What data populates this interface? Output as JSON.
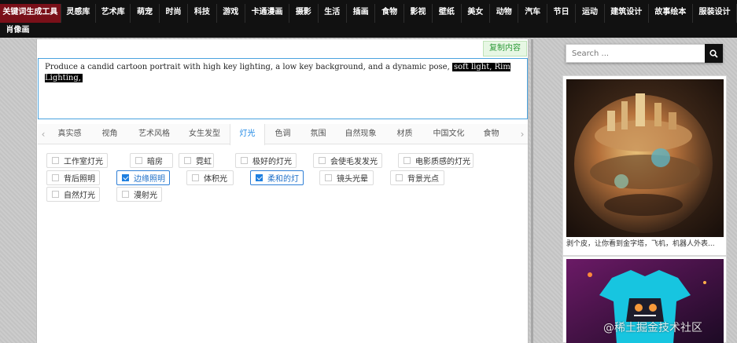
{
  "nav": {
    "row1": [
      "关键词生成工具",
      "灵感库",
      "艺术库",
      "萌宠",
      "时尚",
      "科技",
      "游戏",
      "卡通漫画",
      "摄影",
      "生活",
      "插画",
      "食物",
      "影视",
      "壁纸",
      "美女",
      "动物",
      "汽车",
      "节日",
      "运动",
      "建筑设计",
      "故事绘本",
      "服装设计"
    ],
    "row2": [
      "肖像画"
    ],
    "active": "关键词生成工具"
  },
  "editor": {
    "copy_label": "复制内容",
    "prompt_text": "Produce a candid cartoon portrait with high key lighting, a low key background, and a dynamic pose,",
    "prompt_highlight": "soft light, Rim Lighting,"
  },
  "tabs": {
    "items": [
      "真实感",
      "视角",
      "艺术风格",
      "女生发型",
      "灯光",
      "色调",
      "氛围",
      "自然现象",
      "材质",
      "中国文化",
      "食物"
    ],
    "active": "灯光"
  },
  "options": [
    {
      "label": "工作室灯光",
      "checked": false
    },
    {
      "label": "暗房",
      "checked": false
    },
    {
      "label": "霓虹",
      "checked": false
    },
    {
      "label": "极好的灯光",
      "checked": false
    },
    {
      "label": "会使毛发发光",
      "checked": false
    },
    {
      "label": "电影质感的灯光",
      "checked": false
    },
    {
      "label": "背后照明",
      "checked": false
    },
    {
      "label": "边缘照明",
      "checked": true
    },
    {
      "label": "体积光",
      "checked": false
    },
    {
      "label": "柔和的灯",
      "checked": true
    },
    {
      "label": "镜头光晕",
      "checked": false
    },
    {
      "label": "背景光点",
      "checked": false
    },
    {
      "label": "自然灯光",
      "checked": false
    },
    {
      "label": "漫射光",
      "checked": false
    }
  ],
  "sidebar": {
    "search_placeholder": "Search ...",
    "search_icon": "magnifier-icon",
    "card1_caption": "剥个皮，让你看到金字塔，飞机，机器人外表...",
    "card1_image": "fantasy-planet-city-illustration",
    "card2_image": "colorful-cartoon-tshirt-illustration"
  },
  "watermark": "@稀土掘金技术社区",
  "colors": {
    "accent": "#1e88e5",
    "nav_active": "#7a1019",
    "copy_green": "#2f9b3a"
  }
}
